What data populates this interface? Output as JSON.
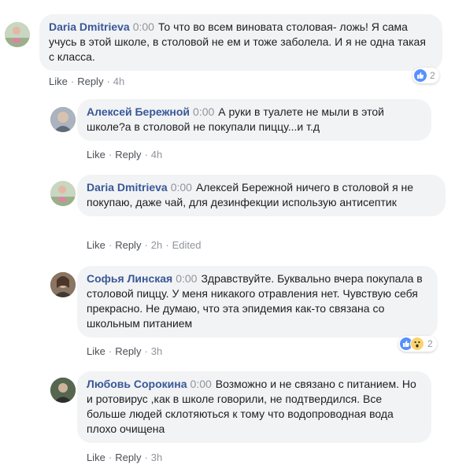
{
  "comments": [
    {
      "author": "Daria Dmitrieva",
      "time_code": "0:00",
      "text": "То что во всем виновата столовая- ложь! Я сама учусь в этой школе, в столовой не ем и тоже заболела. И я не одна такая с класса.",
      "like": "Like",
      "reply": "Reply",
      "age": "4h",
      "reaction_count": "2",
      "reaction_icons": [
        "like-icon"
      ],
      "avatar_color": "#c9d6c0"
    },
    {
      "author": "Алексей Бережной",
      "time_code": "0:00",
      "text": "А руки в туалете не мыли в этой школе?а в столовой не покупали пиццу...и т.д",
      "like": "Like",
      "reply": "Reply",
      "age": "4h",
      "avatar_color": "#8b97a6"
    },
    {
      "author": "Daria Dmitrieva",
      "time_code": "0:00",
      "text": "Алексей Бережной ничего в столовой я не покупаю, даже чай, для дезинфекции использую антисептик",
      "like": "Like",
      "reply": "Reply",
      "age": "2h",
      "edited": "Edited",
      "avatar_color": "#c9d6c0"
    },
    {
      "author": "Софья Линская",
      "time_code": "0:00",
      "text": "Здравствуйте. Буквально вчера покупала в столовой пиццу. У меня никакого отравления нет. Чувствую себя прекрасно. Не думаю, что эта эпидемия как-то связана со школьным питанием",
      "like": "Like",
      "reply": "Reply",
      "age": "3h",
      "reaction_count": "2",
      "reaction_icons": [
        "like-icon",
        "wow-icon"
      ],
      "avatar_color": "#6f5a48"
    },
    {
      "author": "Любовь Сорокина",
      "time_code": "0:00",
      "text": "Возможно и не связано с питанием. Но и ротовирус ,как в школе говорили, не подтвердился. Все больше людей склотяються к тому что водопроводная вода плохо очищена",
      "like": "Like",
      "reply": "Reply",
      "age": "3h",
      "avatar_color": "#3c4a3a"
    }
  ],
  "colors": {
    "author": "#385898",
    "bubble": "#f2f3f5",
    "meta": "#90949c",
    "like_blue": "#5890ff",
    "wow_yellow": "#fcd36a"
  }
}
